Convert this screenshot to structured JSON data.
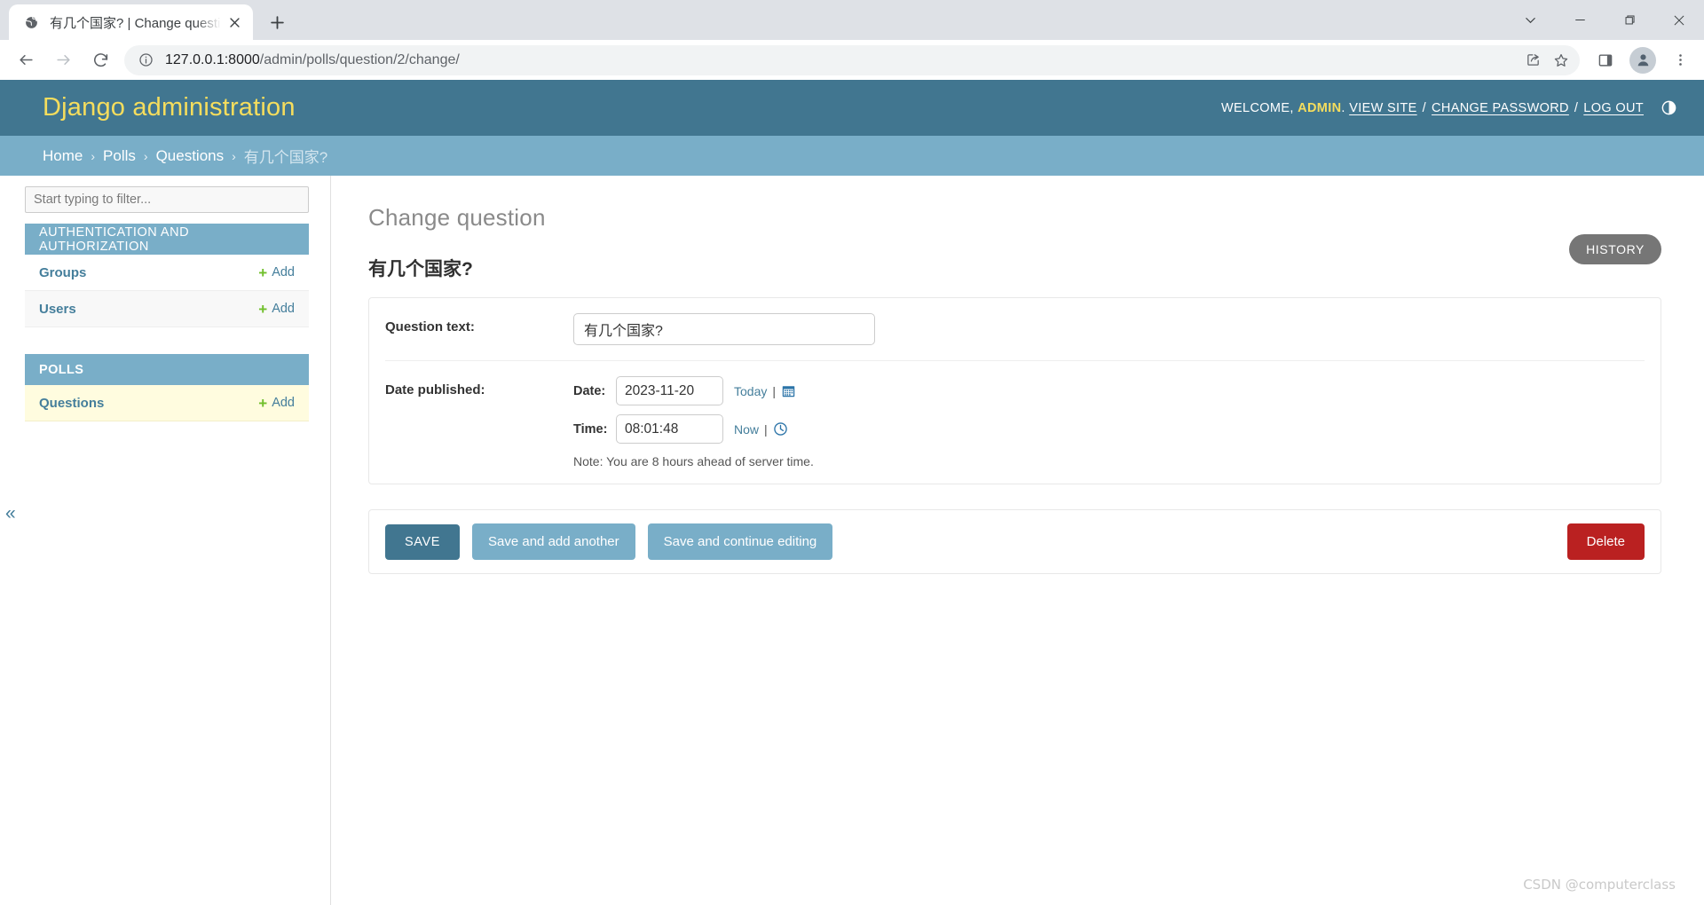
{
  "browser": {
    "tab": {
      "title": "有几个国家?  | Change questio",
      "favicon_icon": "globe-icon",
      "close_icon": "close-icon"
    },
    "new_tab_label": "+",
    "window_controls": [
      {
        "name": "chevron-down",
        "glyph": "⌄"
      },
      {
        "name": "minimize",
        "glyph": "—"
      },
      {
        "name": "maximize",
        "glyph": "❐"
      },
      {
        "name": "close",
        "glyph": "✕"
      }
    ],
    "nav": {
      "back_icon": "back-arrow-icon",
      "forward_icon": "forward-arrow-icon",
      "reload_icon": "reload-icon"
    },
    "omnibox": {
      "info_icon": "info-circle-icon",
      "url_host": "127.0.0.1:8000",
      "url_path": "/admin/polls/question/2/change/",
      "url_full": "127.0.0.1:8000/admin/polls/question/2/change/",
      "share_icon": "share-icon",
      "bookmark_icon": "star-icon"
    },
    "toolbar_right": {
      "sidepanel_icon": "side-panel-icon",
      "profile_icon": "profile-avatar-icon",
      "menu_icon": "three-dot-menu-icon"
    }
  },
  "header": {
    "brand": "Django administration",
    "welcome_prefix": "WELCOME,",
    "username": "ADMIN",
    "username_suffix": ".",
    "links": [
      {
        "label": "VIEW SITE"
      },
      {
        "label": "CHANGE PASSWORD"
      },
      {
        "label": "LOG OUT"
      }
    ],
    "separator": "/",
    "theme_toggle_icon": "theme-toggle-icon"
  },
  "breadcrumbs": {
    "items": [
      "Home",
      "Polls",
      "Questions"
    ],
    "current": "有几个国家?",
    "separator": "›"
  },
  "sidebar": {
    "filter_placeholder": "Start typing to filter...",
    "collapse_glyph": "«",
    "apps": [
      {
        "caption": "AUTHENTICATION AND AUTHORIZATION",
        "bold": false,
        "models": [
          {
            "name": "Groups",
            "add_label": "Add",
            "current": false
          },
          {
            "name": "Users",
            "add_label": "Add",
            "current": false
          }
        ]
      },
      {
        "caption": "POLLS",
        "bold": true,
        "models": [
          {
            "name": "Questions",
            "add_label": "Add",
            "current": true
          }
        ]
      }
    ]
  },
  "content": {
    "page_title": "Change question",
    "object_title": "有几个国家?",
    "history_button": "HISTORY",
    "fields": {
      "question_text": {
        "label": "Question text:",
        "value": "有几个国家?"
      },
      "date_published": {
        "label": "Date published:",
        "date_label": "Date:",
        "date_value": "2023-11-20",
        "date_shortcut": "Today",
        "date_icon": "calendar-icon",
        "time_label": "Time:",
        "time_value": "08:01:48",
        "time_shortcut": "Now",
        "time_icon": "clock-icon",
        "note": "Note: You are 8 hours ahead of server time."
      }
    },
    "buttons": {
      "save": "SAVE",
      "save_add_another": "Save and add another",
      "save_continue": "Save and continue editing",
      "delete": "Delete"
    }
  },
  "watermark": "CSDN @computerclass",
  "colors": {
    "header_teal": "#417690",
    "breadcrumb_blue": "#79aec8",
    "brand_yellow": "#f5dd5d",
    "link_blue": "#447e9b",
    "delete_red": "#ba2121",
    "add_green": "#70bf2b",
    "current_row_yellow": "#fffcdf",
    "history_gray": "#767676"
  }
}
